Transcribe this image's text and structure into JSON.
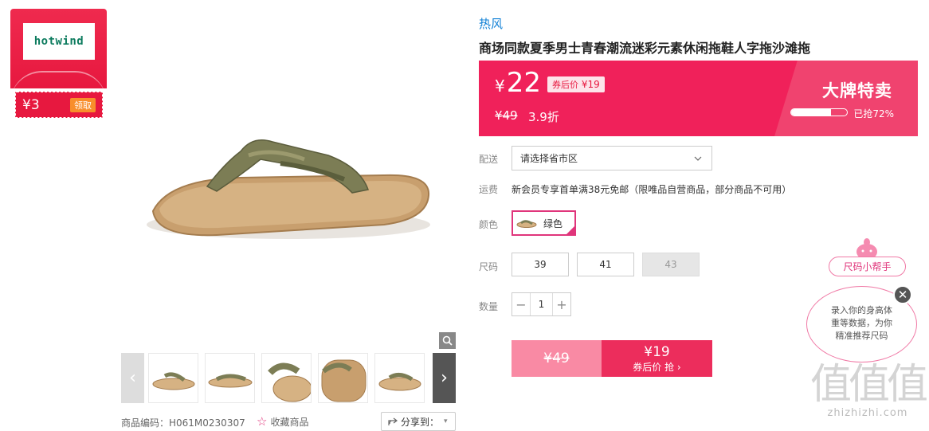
{
  "coupon": {
    "logo_text": "hotwind",
    "amount": "¥3",
    "action": "领取"
  },
  "gallery": {
    "prev": "‹",
    "next": "›",
    "zoom_icon": "zoom-in-icon"
  },
  "meta": {
    "item_code": "商品编码：H061M0230307",
    "favorite": "收藏商品",
    "share": "分享到：",
    "share_icon": "share-icon"
  },
  "product": {
    "brand": "热风",
    "title": "商场同款夏季男士青春潮流迷彩元素休闲拖鞋人字拖沙滩拖"
  },
  "price": {
    "yen": "¥",
    "current": "22",
    "coupon_label": "券后价",
    "coupon_value": "¥19",
    "original": "¥49",
    "discount": "3.9折",
    "promo_title": "大牌特卖",
    "sold_percent": 72,
    "sold_text": "已抢72%",
    "panel_color": "#f0215a"
  },
  "delivery": {
    "label": "配送",
    "value": "请选择省市区"
  },
  "shipping": {
    "label": "运费",
    "text": "新会员专享首单满38元免邮（限唯品自营商品，部分商品不可用）"
  },
  "color": {
    "label": "颜色",
    "option": "绿色"
  },
  "size": {
    "label": "尺码",
    "options": [
      {
        "value": "39",
        "available": true
      },
      {
        "value": "41",
        "available": true
      },
      {
        "value": "43",
        "available": false
      }
    ]
  },
  "quantity": {
    "label": "数量",
    "minus": "−",
    "value": "1",
    "plus": "+"
  },
  "buy": {
    "original": "¥49",
    "coupon_price": "¥19",
    "action": "券后价 抢 ›"
  },
  "helper": {
    "tag": "尺码小帮手",
    "message_lines": [
      "录入你的身高体",
      "重等数据，为你",
      "精准推荐尺码"
    ],
    "close": "✕"
  },
  "watermark": {
    "big": "值值值",
    "site": "zhizhizhi.com"
  }
}
